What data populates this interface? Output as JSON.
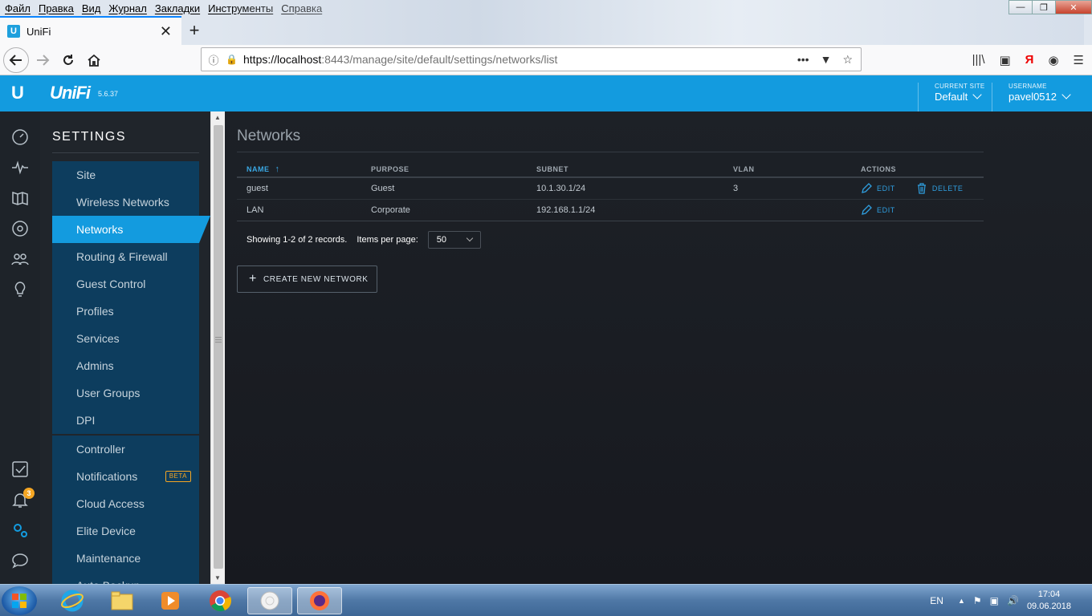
{
  "browser": {
    "menu": [
      "Файл",
      "Правка",
      "Вид",
      "Журнал",
      "Закладки",
      "Инструменты",
      "Справка"
    ],
    "tab_title": "UniFi",
    "url_host": "https://localhost",
    "url_rest": ":8443/manage/site/default/settings/networks/list",
    "yandex_label": "Я"
  },
  "header": {
    "brand": "UniFi",
    "version": "5.6.37",
    "site_label": "CURRENT SITE",
    "site_value": "Default",
    "user_label": "USERNAME",
    "user_value": "pavel0512"
  },
  "iconbar": {
    "notifications_count": "3"
  },
  "settings": {
    "title": "SETTINGS",
    "group1": [
      "Site",
      "Wireless Networks",
      "Networks",
      "Routing & Firewall",
      "Guest Control",
      "Profiles",
      "Services",
      "Admins",
      "User Groups",
      "DPI"
    ],
    "group2": [
      "Controller",
      "Notifications",
      "Cloud Access",
      "Elite Device",
      "Maintenance",
      "Auto Backup"
    ],
    "active": "Networks",
    "beta_label": "BETA"
  },
  "main": {
    "title": "Networks",
    "columns": [
      "NAME",
      "PURPOSE",
      "SUBNET",
      "VLAN",
      "ACTIONS"
    ],
    "sort_indicator": "↑",
    "rows": [
      {
        "name": "guest",
        "purpose": "Guest",
        "subnet": "10.1.30.1/24",
        "vlan": "3",
        "edit": "EDIT",
        "delete": "DELETE"
      },
      {
        "name": "LAN",
        "purpose": "Corporate",
        "subnet": "192.168.1.1/24",
        "vlan": "",
        "edit": "EDIT",
        "delete": ""
      }
    ],
    "showing": "Showing 1-2 of 2 records.",
    "items_per_page_label": "Items per page:",
    "items_per_page_value": "50",
    "create_button": "CREATE NEW NETWORK"
  },
  "taskbar": {
    "lang": "EN",
    "time": "17:04",
    "date": "09.06.2018"
  },
  "colors": {
    "accent": "#139bdf",
    "sidebar_item": "#0d3d5e",
    "badge": "#f5a623"
  }
}
